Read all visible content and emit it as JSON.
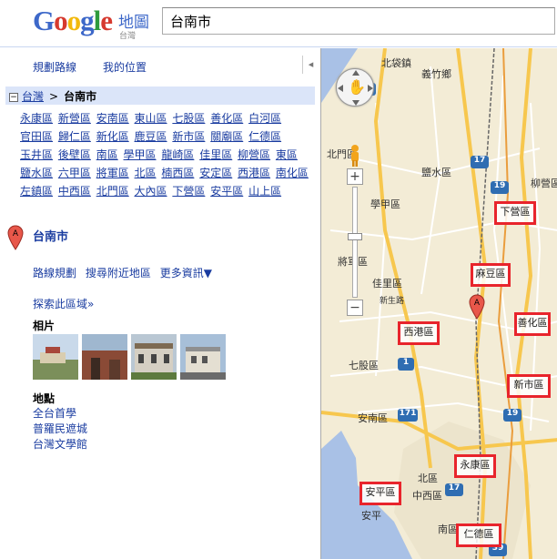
{
  "header": {
    "logo_text": "Google",
    "logo_sub": "地圖",
    "logo_region": "台灣",
    "search_value": "台南市"
  },
  "toolbar": {
    "directions": "規劃路線",
    "my_location": "我的位置",
    "collapse": "◂"
  },
  "breadcrumb": {
    "toggle": "−",
    "parent": "台灣",
    "separator": ">",
    "current": "台南市"
  },
  "districts": [
    "永康區",
    "新營區",
    "安南區",
    "東山區",
    "七股區",
    "善化區",
    "白河區",
    "官田區",
    "歸仁區",
    "新化區",
    "鹿豆區",
    "新市區",
    "關廟區",
    "仁德區",
    "玉井區",
    "後壁區",
    "南區",
    "學甲區",
    "龍崎區",
    "佳里區",
    "柳營區",
    "東區",
    "鹽水區",
    "六甲區",
    "將軍區",
    "北區",
    "楠西區",
    "安定區",
    "西港區",
    "南化區",
    "左鎮區",
    "中西區",
    "北門區",
    "大內區",
    "下營區",
    "安平區",
    "山上區"
  ],
  "place": {
    "marker_letter": "A",
    "title": "台南市",
    "actions": [
      "路線規劃",
      "搜尋附近地區",
      "更多資訊▼"
    ],
    "explore": "探索此區域»",
    "photos_title": "相片",
    "places_title": "地點",
    "places": [
      "全台首學",
      "普羅民遮城",
      "台灣文學館"
    ]
  },
  "map": {
    "labels": [
      {
        "text": "北袋鎮"
      },
      {
        "text": "義竹鄉"
      },
      {
        "text": "北門區"
      },
      {
        "text": "鹽水區"
      },
      {
        "text": "學甲區"
      },
      {
        "text": "佳里區"
      },
      {
        "text": "將軍區"
      },
      {
        "text": "新生路"
      },
      {
        "text": "七股區"
      },
      {
        "text": "安南區"
      },
      {
        "text": "北區"
      },
      {
        "text": "中西區"
      },
      {
        "text": "安平"
      },
      {
        "text": "南區"
      },
      {
        "text": "柳營區"
      }
    ],
    "boxed": [
      {
        "text": "下營區"
      },
      {
        "text": "麻豆區"
      },
      {
        "text": "西港區"
      },
      {
        "text": "善化區"
      },
      {
        "text": "新市區"
      },
      {
        "text": "永康區"
      },
      {
        "text": "安平區"
      },
      {
        "text": "仁德區"
      }
    ],
    "shields": [
      "1",
      "17",
      "19",
      "1",
      "171",
      "17",
      "39",
      "19"
    ],
    "pan_label": "✋",
    "zoom_in": "+",
    "zoom_out": "−",
    "accent": "#e8242c",
    "highway_color": "#f7c74e"
  }
}
